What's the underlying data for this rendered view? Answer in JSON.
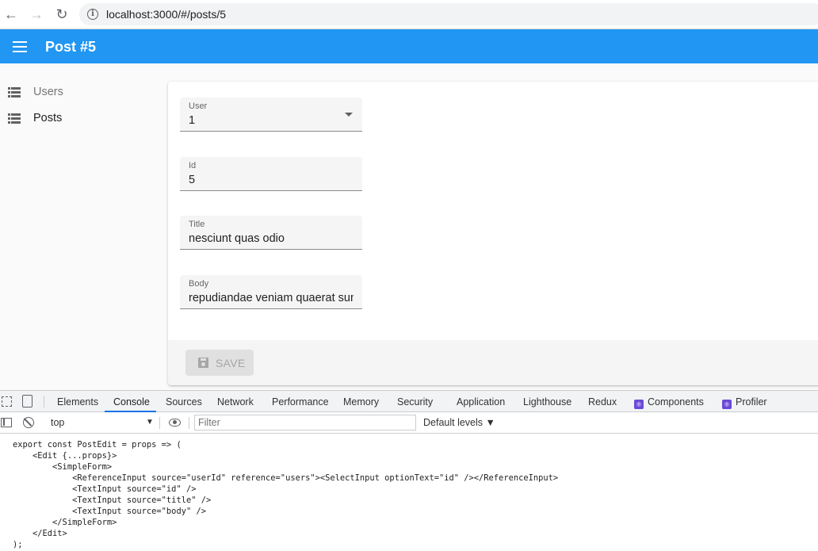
{
  "browser": {
    "url": "localhost:3000/#/posts/5"
  },
  "app_bar": {
    "title": "Post #5"
  },
  "sidebar": {
    "items": [
      {
        "label": "Users",
        "icon": "list-icon"
      },
      {
        "label": "Posts",
        "icon": "list-icon"
      }
    ]
  },
  "form": {
    "fields": [
      {
        "label": "User",
        "value": "1"
      },
      {
        "label": "Id",
        "value": "5"
      },
      {
        "label": "Title",
        "value": "nesciunt quas odio"
      },
      {
        "label": "Body",
        "value": "repudiandae veniam quaerat sunt sed"
      }
    ],
    "save_label": "SAVE"
  },
  "devtools": {
    "tabs": [
      "Elements",
      "Console",
      "Sources",
      "Network",
      "Performance",
      "Memory",
      "Security",
      "Application",
      "Lighthouse",
      "Redux",
      "Components",
      "Profiler"
    ],
    "active_tab": "Console",
    "context": "top",
    "filter_placeholder": "Filter",
    "levels": "Default levels ▼",
    "console_lines": [
      "export const PostEdit = props => (",
      "    <Edit {...props}>",
      "        <SimpleForm>",
      "            <ReferenceInput source=\"userId\" reference=\"users\"><SelectInput optionText=\"id\" /></ReferenceInput>",
      "            <TextInput source=\"id\" />",
      "            <TextInput source=\"title\" />",
      "            <TextInput source=\"body\" />",
      "        </SimpleForm>",
      "    </Edit>",
      ");"
    ]
  },
  "colors": {
    "app_bar": "#2196f3",
    "devtools_active": "#1a73e8"
  }
}
